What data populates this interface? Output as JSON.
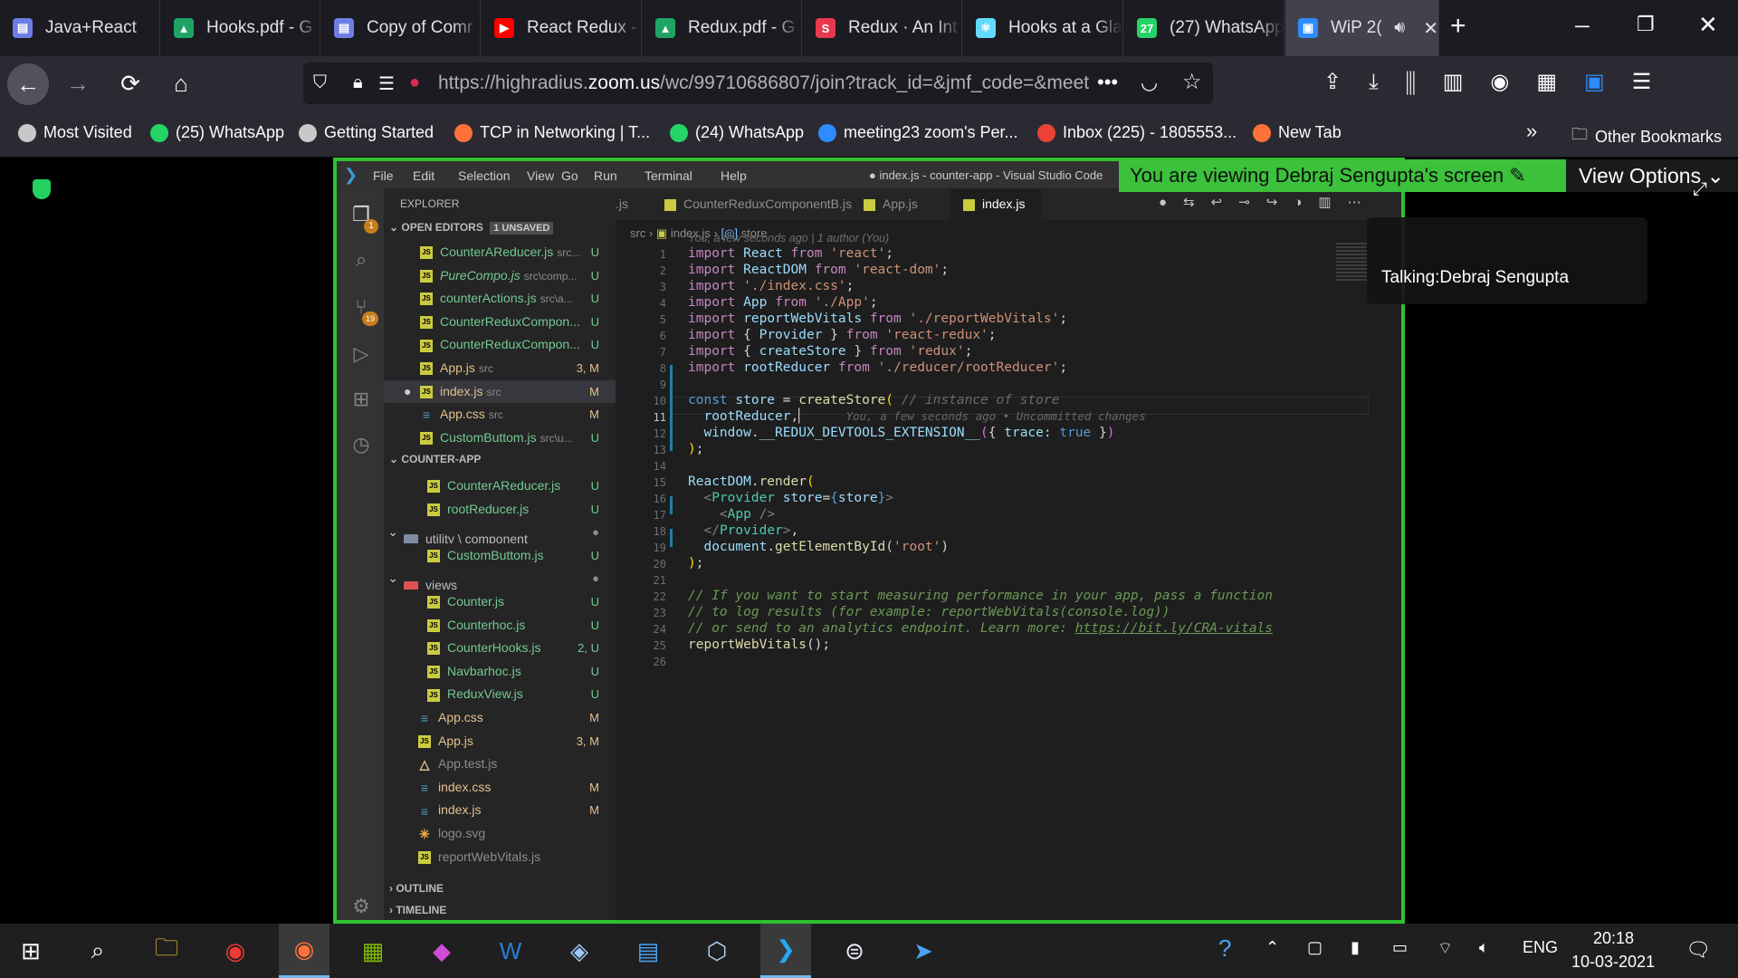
{
  "browser": {
    "tabs": [
      {
        "label": "Java+React",
        "color": "#6d7de6",
        "glyph": "▤"
      },
      {
        "label": "Hooks.pdf - G",
        "color": "#1fa463",
        "glyph": "▲"
      },
      {
        "label": "Copy of Comr",
        "color": "#6d7de6",
        "glyph": "▤"
      },
      {
        "label": "React Redux -",
        "color": "#ff0000",
        "glyph": "▶"
      },
      {
        "label": "Redux.pdf - G",
        "color": "#1fa463",
        "glyph": "▲"
      },
      {
        "label": "Redux · An Int",
        "color": "#e8384f",
        "glyph": "S"
      },
      {
        "label": "Hooks at a Gla",
        "color": "#61dafb",
        "glyph": "⚛"
      },
      {
        "label": "(27) WhatsApp",
        "color": "#25d366",
        "glyph": "27"
      },
      {
        "label": "WiP 2(",
        "color": "#2d8cff",
        "glyph": "▣"
      }
    ],
    "new_tab": "+",
    "url_prefix": "https://highradius.",
    "url_domain": "zoom.us",
    "url_rest": "/wc/99710686807/join?track_id=&jmf_code=&meet",
    "bookmarks": [
      "Most Visited",
      "(25) WhatsApp",
      "Getting Started",
      "TCP in Networking | T...",
      "(24) WhatsApp",
      "meeting23 zoom's Per...",
      "Inbox (225) - 1805553...",
      "New Tab"
    ],
    "other_bookmarks": "Other Bookmarks"
  },
  "zoom": {
    "banner": "You are viewing Debraj Sengupta's screen",
    "view_options": "View Options",
    "talking": "Talking:Debraj Sengupta"
  },
  "vscode": {
    "menu": [
      "File",
      "Edit",
      "Selection",
      "View",
      "Go",
      "Run",
      "Terminal",
      "Help"
    ],
    "title": "● index.js - counter-app - Visual Studio Code",
    "explorer_title": "EXPLORER",
    "open_editors": "OPEN EDITORS",
    "unsaved": "1 UNSAVED",
    "open_files": [
      {
        "name": "CounterAReducer.js",
        "dim": "src...",
        "status": "U",
        "kind": "js"
      },
      {
        "name": "PureCompo.js",
        "dim": "src\\comp...",
        "status": "U",
        "kind": "js"
      },
      {
        "name": "counterActions.js",
        "dim": "src\\a...",
        "status": "U",
        "kind": "js"
      },
      {
        "name": "CounterReduxCompon...",
        "dim": "",
        "status": "U",
        "kind": "js"
      },
      {
        "name": "CounterReduxCompon...",
        "dim": "",
        "status": "U",
        "kind": "js"
      },
      {
        "name": "App.js",
        "dim": "src",
        "status": "3, M",
        "kind": "js"
      },
      {
        "name": "index.js",
        "dim": "src",
        "status": "M",
        "kind": "js"
      },
      {
        "name": "App.css",
        "dim": "src",
        "status": "M",
        "kind": "css"
      },
      {
        "name": "CustomButtom.js",
        "dim": "src\\u...",
        "status": "U",
        "kind": "js"
      }
    ],
    "project": "COUNTER-APP",
    "tree": [
      {
        "name": "CounterAReducer.js",
        "status": "U",
        "kind": "js",
        "indent": 2
      },
      {
        "name": "rootReducer.js",
        "status": "U",
        "kind": "js",
        "indent": 2
      },
      {
        "name": "utility \\ component",
        "status": "●",
        "kind": "folder",
        "indent": 1
      },
      {
        "name": "CustomButtom.js",
        "status": "U",
        "kind": "js",
        "indent": 2
      },
      {
        "name": "views",
        "status": "●",
        "kind": "folder-red",
        "indent": 1
      },
      {
        "name": "Counter.js",
        "status": "U",
        "kind": "js",
        "indent": 2
      },
      {
        "name": "Counterhoc.js",
        "status": "U",
        "kind": "js",
        "indent": 2
      },
      {
        "name": "CounterHooks.js",
        "status": "2, U",
        "kind": "js",
        "indent": 2
      },
      {
        "name": "Navbarhoc.js",
        "status": "U",
        "kind": "js",
        "indent": 2
      },
      {
        "name": "ReduxView.js",
        "status": "U",
        "kind": "js",
        "indent": 2
      },
      {
        "name": "App.css",
        "status": "M",
        "kind": "css",
        "indent": 1
      },
      {
        "name": "App.js",
        "status": "3, M",
        "kind": "js",
        "indent": 1
      },
      {
        "name": "App.test.js",
        "status": "",
        "kind": "test",
        "indent": 1
      },
      {
        "name": "index.css",
        "status": "M",
        "kind": "css",
        "indent": 1
      },
      {
        "name": "index.js",
        "status": "M",
        "kind": "css",
        "indent": 1
      },
      {
        "name": "logo.svg",
        "status": "",
        "kind": "svg",
        "indent": 1
      },
      {
        "name": "reportWebVitals.js",
        "status": "",
        "kind": "js",
        "indent": 1
      }
    ],
    "outline": "OUTLINE",
    "timeline": "TIMELINE",
    "editor_tabs": [
      ".js",
      "CounterReduxComponentB.js",
      "App.js",
      "index.js"
    ],
    "breadcrumb": [
      "src",
      "index.js",
      "store"
    ],
    "blame": "You, a few seconds ago | 1 author (You)",
    "inline_blame": "You, a few seconds ago • Uncommitted changes",
    "lines": [
      "1",
      "2",
      "3",
      "4",
      "5",
      "6",
      "7",
      "8",
      "9",
      "10",
      "11",
      "12",
      "13",
      "14",
      "15",
      "16",
      "17",
      "18",
      "19",
      "20",
      "21",
      "22",
      "23",
      "24",
      "25",
      "26"
    ]
  },
  "taskbar": {
    "lang": "ENG",
    "time": "20:18",
    "date": "10-03-2021"
  }
}
